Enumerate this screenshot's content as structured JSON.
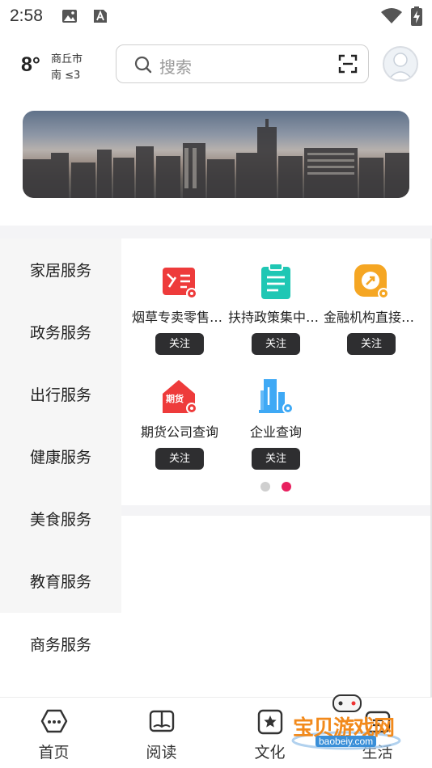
{
  "status_bar": {
    "time": "2:58"
  },
  "weather": {
    "temperature": "8°",
    "city": "商丘市",
    "wind": "南 ≤3"
  },
  "search": {
    "placeholder": "搜索"
  },
  "categories": [
    {
      "label": "家居服务"
    },
    {
      "label": "政务服务"
    },
    {
      "label": "出行服务"
    },
    {
      "label": "健康服务"
    },
    {
      "label": "美食服务"
    },
    {
      "label": "教育服务"
    },
    {
      "label": "商务服务"
    }
  ],
  "services": [
    {
      "name": "烟草专卖零售许可证查询",
      "follow": "关注",
      "icon": "license-icon",
      "color": "#ee3b3b"
    },
    {
      "name": "扶持政策集中查询",
      "follow": "关注",
      "icon": "clipboard-icon",
      "color": "#1fc7b4"
    },
    {
      "name": "金融机构直接查询",
      "follow": "关注",
      "icon": "finance-icon",
      "color": "#f5a623"
    },
    {
      "name": "期货公司查询",
      "follow": "关注",
      "icon": "futures-house-icon",
      "color": "#ee3b3b",
      "badge": "期货"
    },
    {
      "name": "企业查询",
      "follow": "关注",
      "icon": "enterprise-building-icon",
      "color": "#3fa9f5"
    }
  ],
  "pager": {
    "pages": 2,
    "current": 2,
    "inactive_color": "#cfcfcf",
    "active_color": "#e8205f"
  },
  "bottom_nav": [
    {
      "label": "首页",
      "icon": "home-icon"
    },
    {
      "label": "阅读",
      "icon": "book-icon"
    },
    {
      "label": "文化",
      "icon": "culture-star-icon"
    },
    {
      "label": "生活",
      "icon": "life-icon"
    }
  ],
  "watermark": {
    "title": "宝贝游戏网",
    "url": "baobeiy.com"
  }
}
